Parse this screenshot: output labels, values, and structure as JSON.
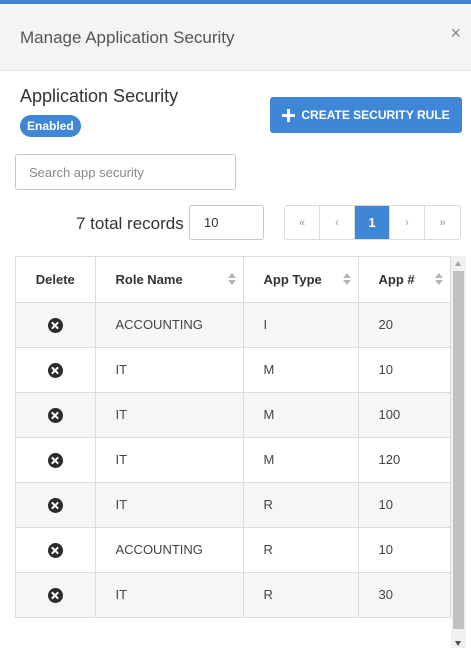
{
  "modal": {
    "title": "Manage Application Security",
    "close_glyph": "×"
  },
  "section": {
    "title": "Application Security",
    "status_badge": "Enabled"
  },
  "toolbar": {
    "create_label": "CREATE SECURITY RULE"
  },
  "search": {
    "placeholder": "Search app security",
    "value": ""
  },
  "records": {
    "total_text": "7 total records",
    "page_size": "10"
  },
  "pagination": {
    "first": "«",
    "prev": "‹",
    "current": "1",
    "next": "›",
    "last": "»"
  },
  "table": {
    "headers": [
      "Delete",
      "Role Name",
      "App Type",
      "App #"
    ],
    "rows": [
      {
        "role": "ACCOUNTING",
        "type": "I",
        "app": "20"
      },
      {
        "role": "IT",
        "type": "M",
        "app": "10"
      },
      {
        "role": "IT",
        "type": "M",
        "app": "100"
      },
      {
        "role": "IT",
        "type": "M",
        "app": "120"
      },
      {
        "role": "IT",
        "type": "R",
        "app": "10"
      },
      {
        "role": "ACCOUNTING",
        "type": "R",
        "app": "10"
      },
      {
        "role": "IT",
        "type": "R",
        "app": "30"
      }
    ]
  },
  "colors": {
    "accent": "#3f87d6",
    "header_bg": "#f3f4f6",
    "row_alt": "#f6f6f6"
  },
  "icons": {
    "close": "close-icon",
    "create": "plus-icon",
    "delete": "delete-circle-x-icon",
    "sort": "sort-icon"
  }
}
